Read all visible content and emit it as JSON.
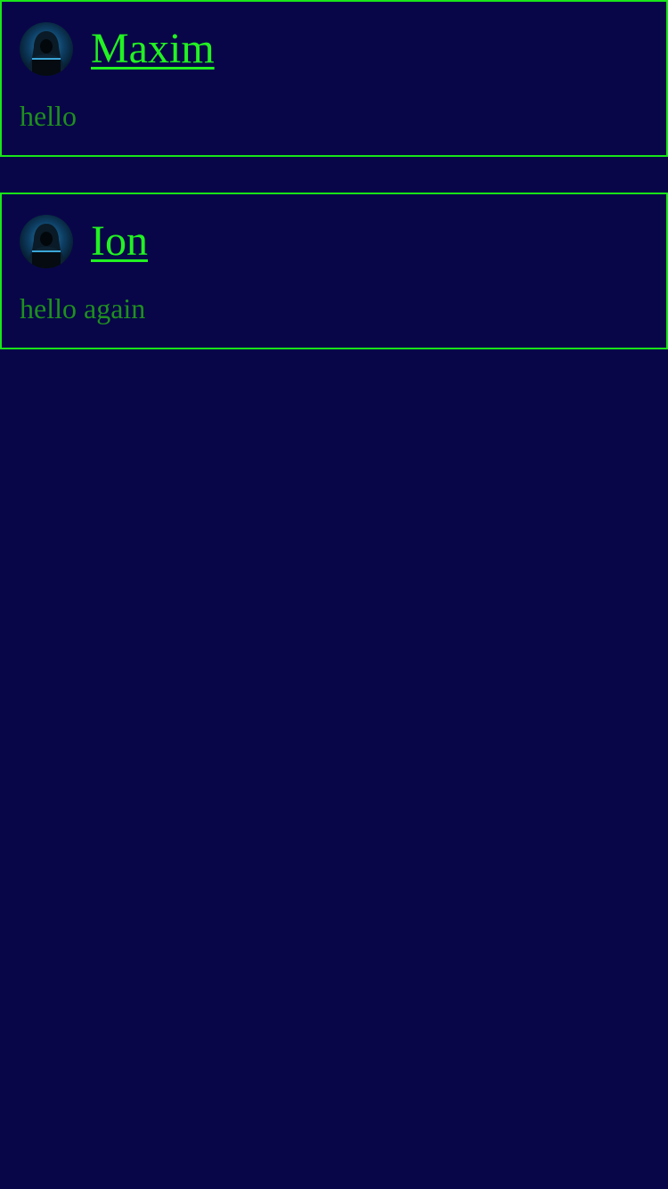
{
  "theme": {
    "background": "#080648",
    "border": "#19e619",
    "author_color": "#22f222",
    "message_color": "#1f8f1f"
  },
  "posts": [
    {
      "author": "Maxim",
      "message": "hello",
      "avatar_icon": "hooded-hacker-avatar"
    },
    {
      "author": "Ion",
      "message": "hello again",
      "avatar_icon": "hooded-hacker-avatar"
    }
  ]
}
